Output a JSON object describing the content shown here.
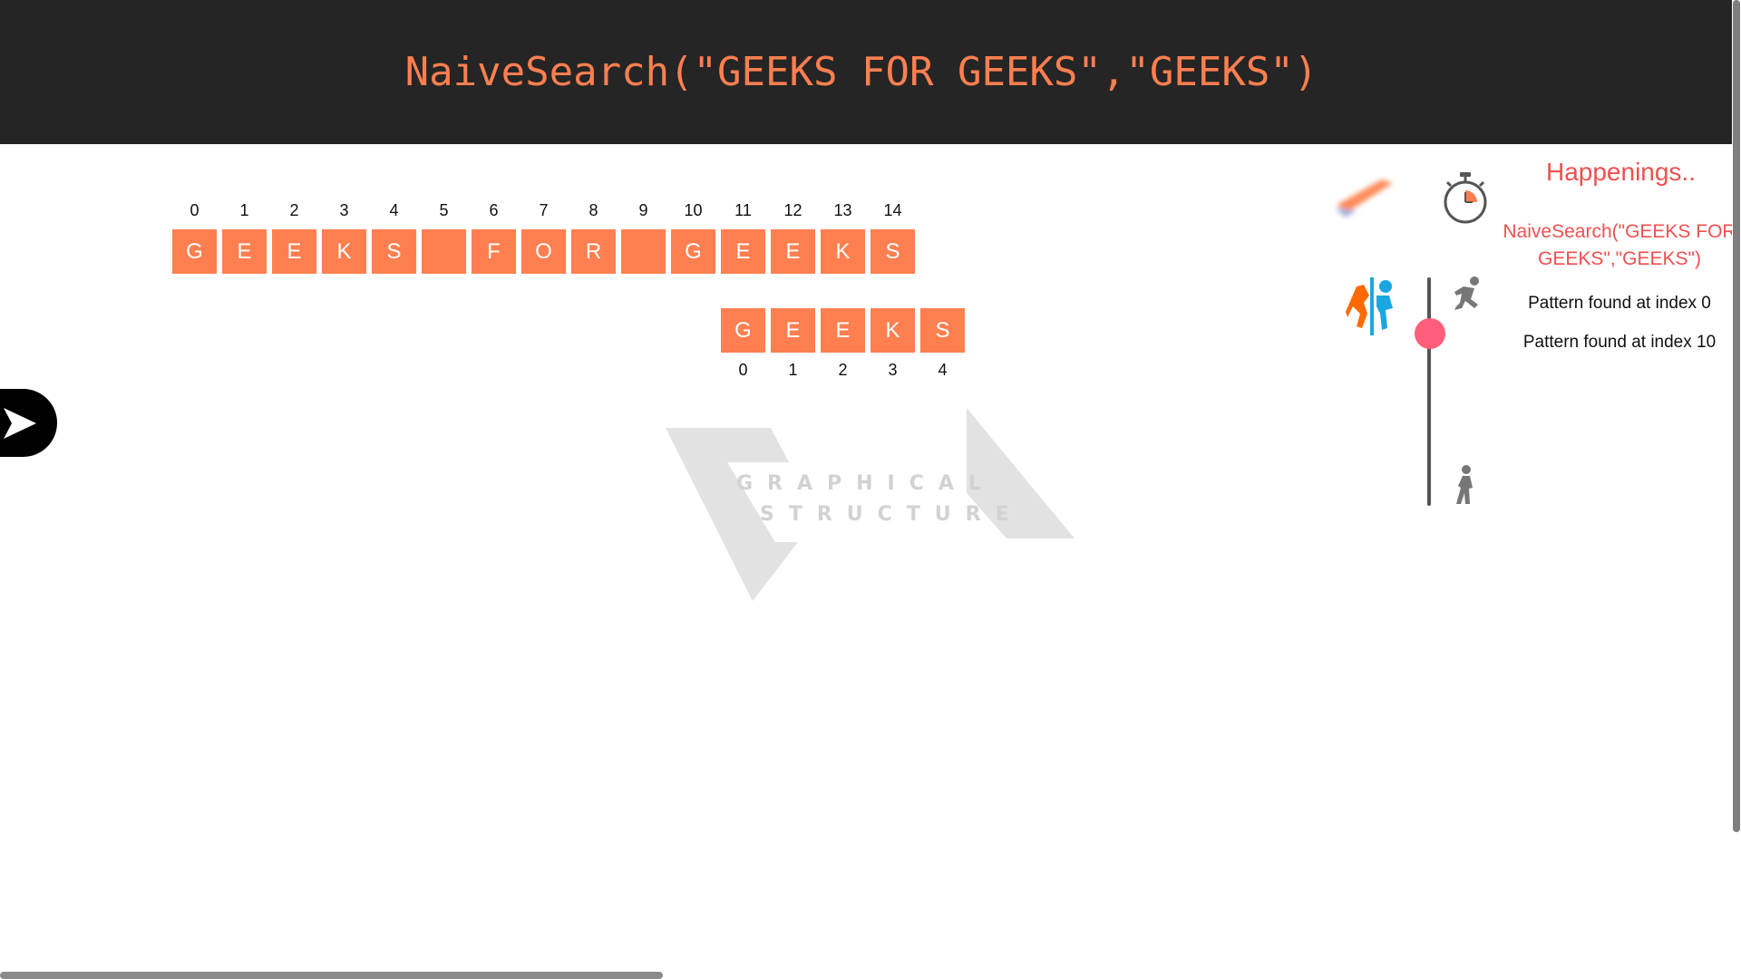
{
  "header": {
    "title": "NaiveSearch(\"GEEKS FOR GEEKS\",\"GEEKS\")"
  },
  "text_array": {
    "indices": [
      "0",
      "1",
      "2",
      "3",
      "4",
      "5",
      "6",
      "7",
      "8",
      "9",
      "10",
      "11",
      "12",
      "13",
      "14"
    ],
    "chars": [
      "G",
      "E",
      "E",
      "K",
      "S",
      " ",
      "F",
      "O",
      "R",
      " ",
      "G",
      "E",
      "E",
      "K",
      "S"
    ]
  },
  "pattern_array": {
    "chars": [
      "G",
      "E",
      "E",
      "K",
      "S"
    ],
    "indices": [
      "0",
      "1",
      "2",
      "3",
      "4"
    ]
  },
  "watermark": {
    "line1": "GRAPHICAL",
    "line2": "STRUCTURE"
  },
  "happenings": {
    "title": "Happenings..",
    "current": "NaiveSearch(\"GEEKS FOR GEEKS\",\"GEEKS\")",
    "log": [
      "Pattern found at index 0",
      "Pattern found at index 10"
    ]
  },
  "speed_slider": {
    "level": 0.2
  },
  "colors": {
    "accent": "#ff7f50",
    "header_bg": "#252525",
    "happenings": "#f05050",
    "knob": "#ff5e7a"
  }
}
